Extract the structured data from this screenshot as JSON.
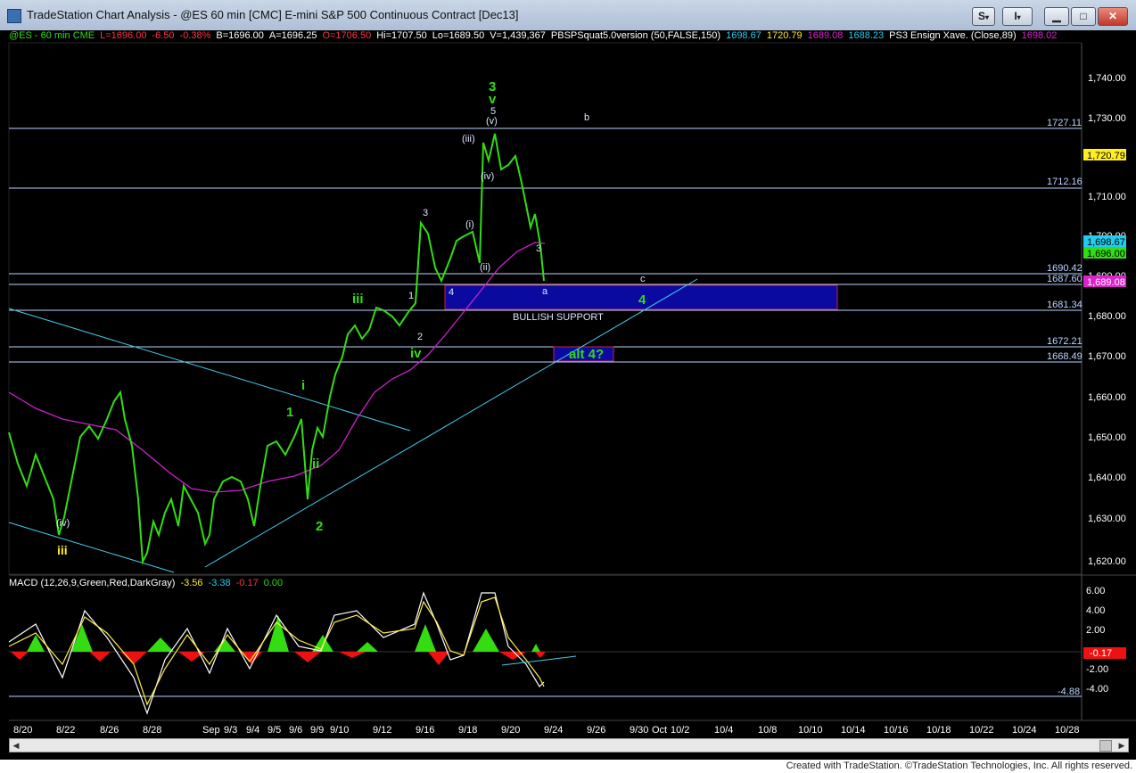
{
  "window": {
    "title": "TradeStation Chart Analysis - @ES 60 min [CMC] E-mini S&P 500 Continuous Contract [Dec13]",
    "buttons": [
      "S",
      "I"
    ]
  },
  "status": {
    "symbol": "@ES - 60 min  CME",
    "last": "L=1696.00",
    "change": "-6.50",
    "pct": "-0.38%",
    "bid": "B=1696.00",
    "ask": "A=1696.25",
    "open": "O=1706.50",
    "hi": "Hi=1707.50",
    "lo": "Lo=1689.50",
    "vol": "V=1,439,367",
    "indicator": "PBSPSquat5.0version (50,FALSE,150)",
    "ind_values": [
      "1698.67",
      "1720.79",
      "1689.08",
      "1688.23"
    ],
    "ensign": "PS3 Ensign Xave. (Close,89)",
    "ensign_value": "1698.02"
  },
  "macd": {
    "label": "MACD (12,26,9,Green,Red,DarkGray)",
    "values": [
      "-3.56",
      "-3.38",
      "-0.17",
      "0.00"
    ]
  },
  "price_axis": {
    "ticks": [
      "1,740.00",
      "1,730.00",
      "1,710.00",
      "1,700.00",
      "1,690.00",
      "1,680.00",
      "1,670.00",
      "1,660.00",
      "1,650.00",
      "1,640.00",
      "1,630.00",
      "1,620.00"
    ],
    "tags": [
      "1,720.79",
      "1,698.67",
      "1,696.00",
      "1,689.08"
    ]
  },
  "macd_axis": {
    "ticks": [
      "6.00",
      "4.00",
      "2.00",
      "-2.00",
      "-4.00"
    ],
    "tags": [
      "-0.17"
    ],
    "level": "-4.88"
  },
  "levels": [
    "1727.11",
    "1712.16",
    "1690.42",
    "1687.60",
    "1681.34",
    "1672.21",
    "1668.49"
  ],
  "date_axis": [
    "8/20",
    "8/22",
    "8/26",
    "8/28",
    "Sep",
    "9/3",
    "9/4",
    "9/5",
    "9/6",
    "9/9",
    "9/10",
    "9/12",
    "9/16",
    "9/18",
    "9/20",
    "9/24",
    "9/26",
    "9/30",
    "Oct",
    "10/2",
    "10/4",
    "10/8",
    "10/10",
    "10/14",
    "10/16",
    "10/18",
    "10/22",
    "10/24",
    "10/28"
  ],
  "annotations": {
    "wave_3": "3",
    "wave_v": "v",
    "wave_5": "5",
    "wave_v_paren": "(v)",
    "wave_iii_paren": "(iii)",
    "wave_iv_paren": "(iv)",
    "wave_i_paren": "(i)",
    "wave_ii_paren": "(ii)",
    "small_3": "3",
    "small_4": "4",
    "small_1": "1",
    "small_2": "2",
    "green_iii": "iii",
    "green_iv": "iv",
    "green_i": "i",
    "green_ii": "ii",
    "green_1": "1",
    "green_2": "2",
    "green_4": "4",
    "yellow_iii": "iii",
    "b": "b",
    "c": "c",
    "a": "a",
    "small_3b": "3",
    "bullish_support": "BULLISH SUPPORT",
    "alt4": "alt 4?",
    "paren_iv_low": "(iv)"
  },
  "footer": "Created with TradeStation. ©TradeStation Technologies, Inc. All rights reserved.",
  "colors": {
    "background": "#000000",
    "price_bars": "#33dd11",
    "moving_average": "#cc22cc",
    "trendline": "#44ccee",
    "level_lines": "#bcd4ff",
    "support_box": "#0a0aa0",
    "macd_line": "#ffffff",
    "signal_line": "#ffee44"
  }
}
